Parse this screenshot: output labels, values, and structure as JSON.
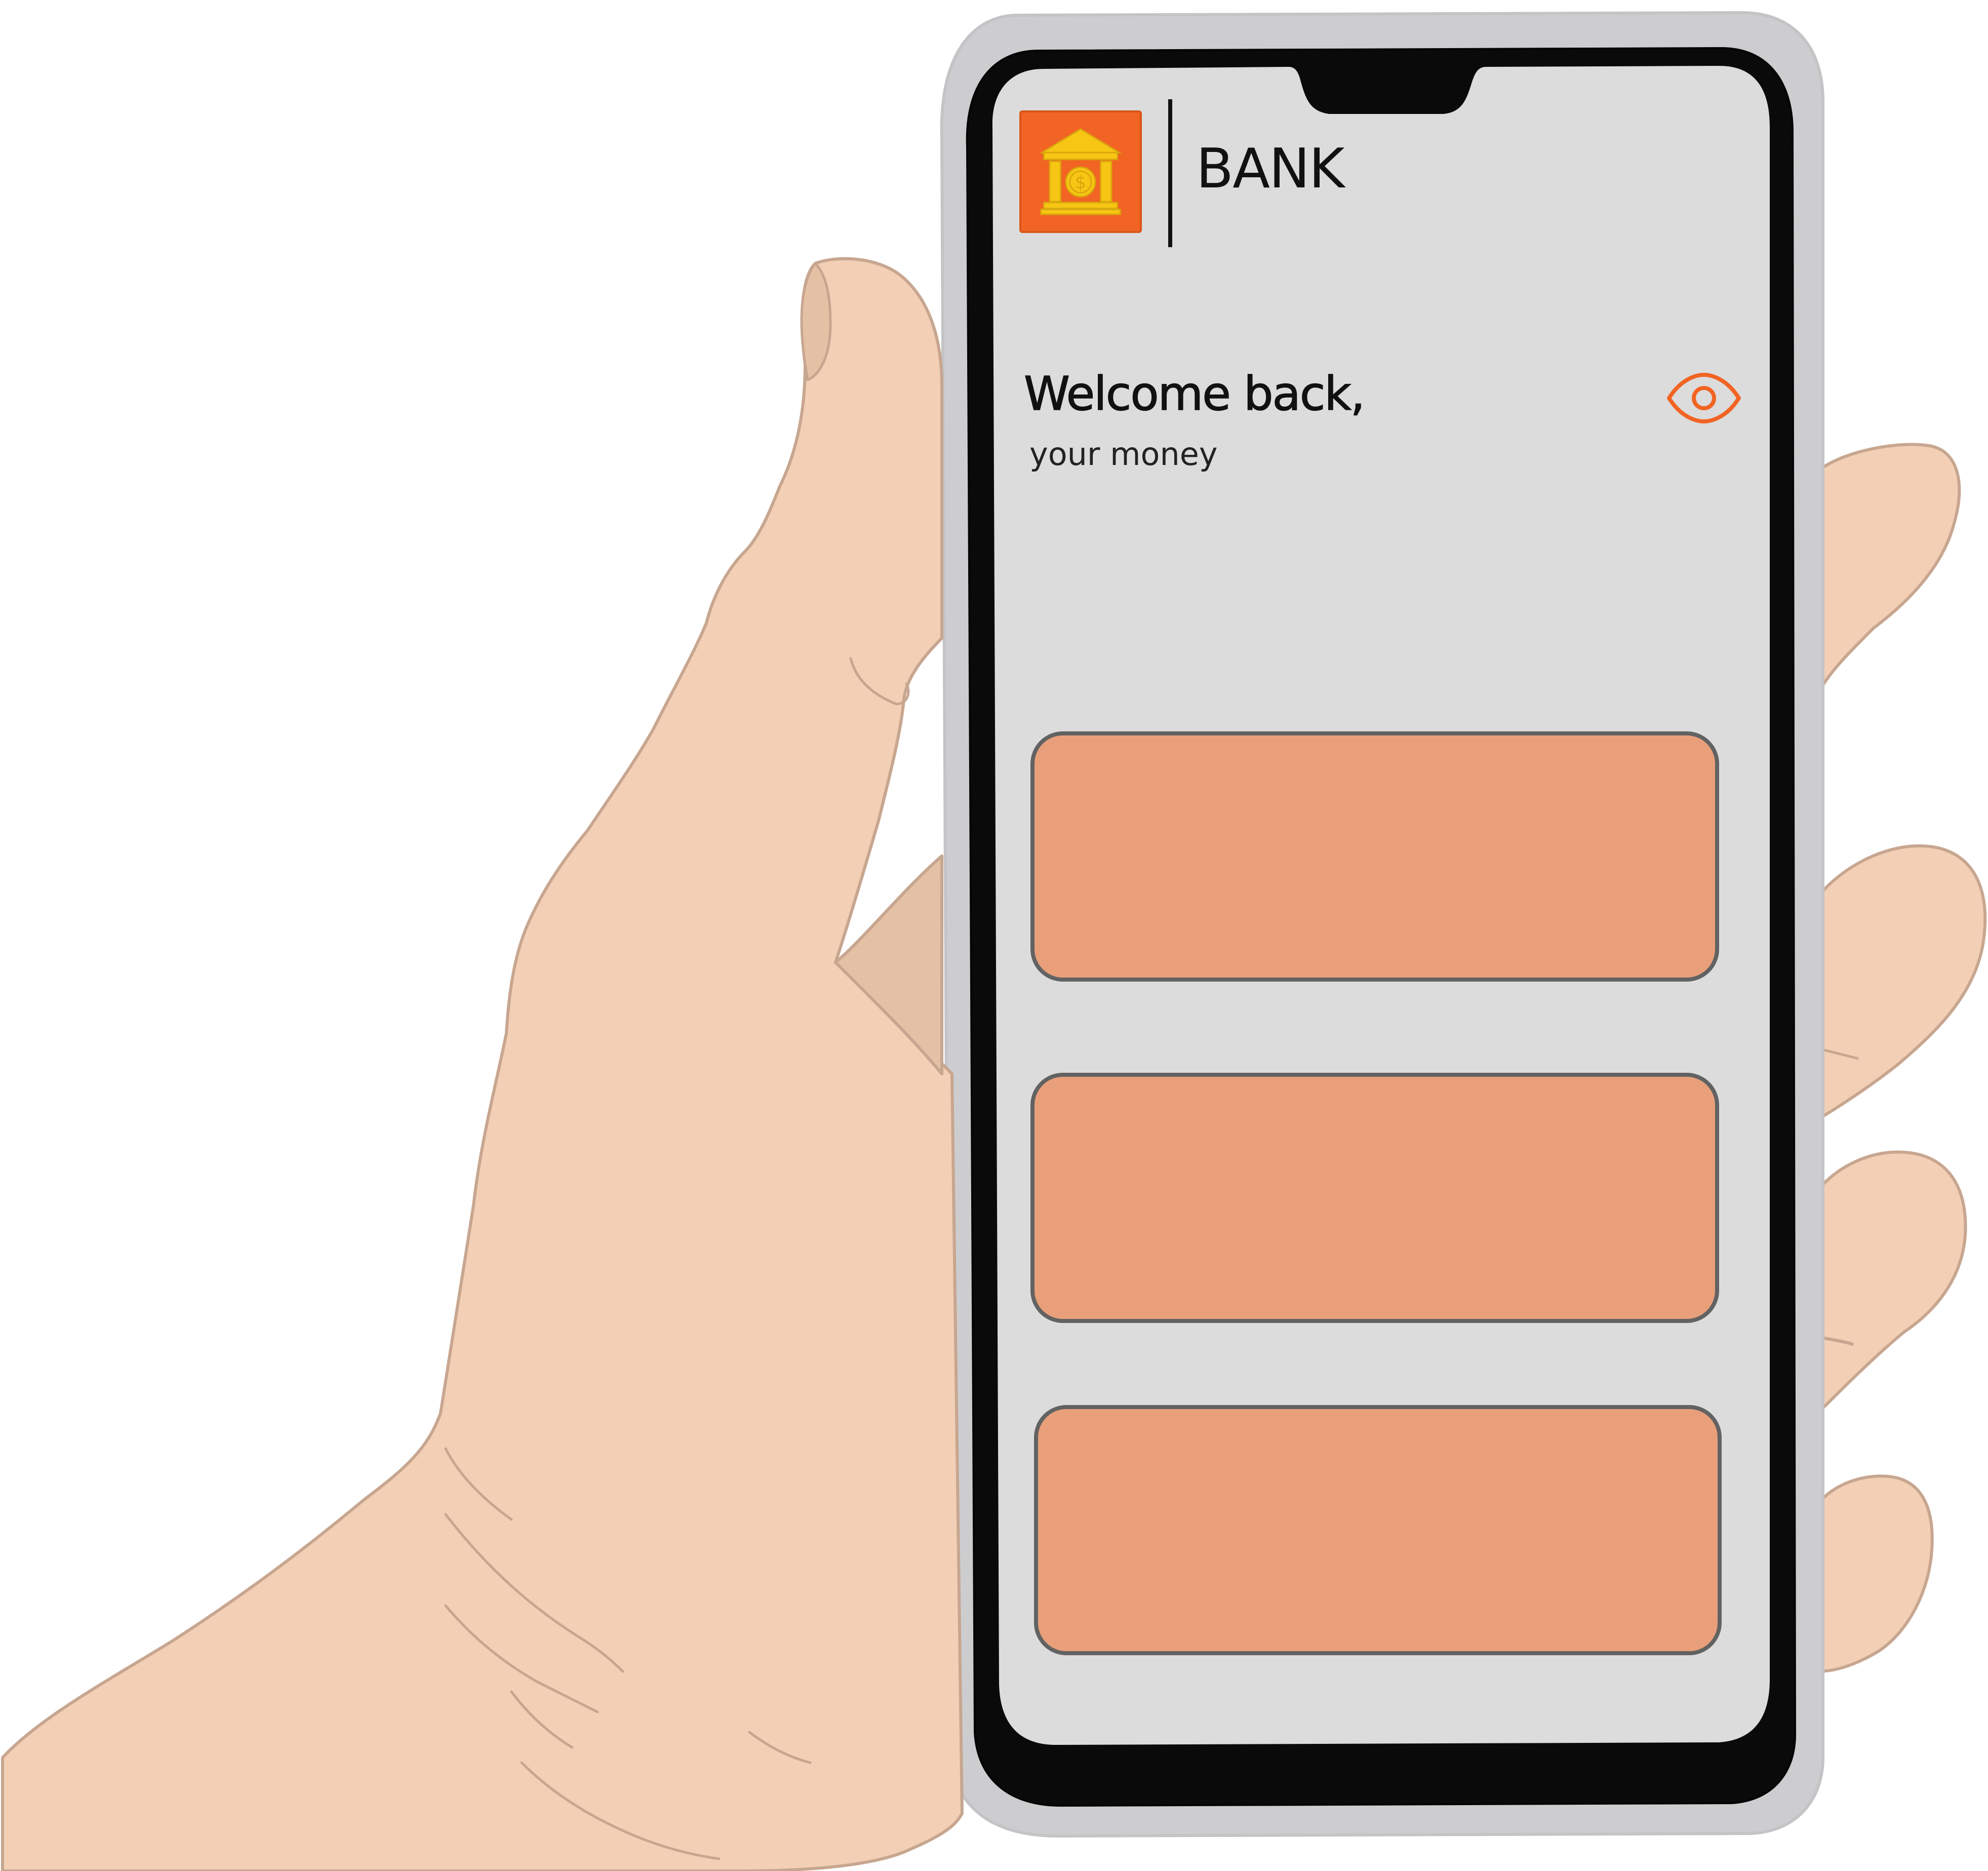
{
  "app": {
    "brand_name": "BANK",
    "logo_icon": "bank-building-dollar-icon"
  },
  "welcome": {
    "title": "Welcome back,",
    "subtitle": "your money"
  },
  "balance_visibility": {
    "icon": "eye-icon"
  },
  "cards": [
    {
      "id": "card-1",
      "label": ""
    },
    {
      "id": "card-2",
      "label": ""
    },
    {
      "id": "card-3",
      "label": ""
    }
  ],
  "colors": {
    "accent": "#f26423",
    "card_fill": "#e9a07a",
    "card_border": "#626262",
    "screen_bg": "#dcdcdd",
    "phone_body": "#0a0a0a",
    "phone_case": "#cdcdcf",
    "skin": "#f2cfb5",
    "skin_outline": "#c7a690",
    "skin_shadow": "#e4c0a5",
    "logo_gold": "#f7c614"
  }
}
